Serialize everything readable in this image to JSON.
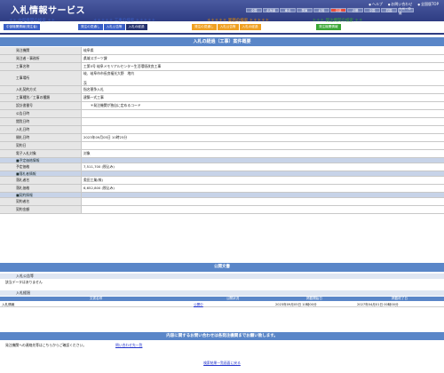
{
  "header": {
    "logo": "入札情報サービス",
    "links": [
      "ヘルプ",
      "お問い合わせ",
      "全国版TOP"
    ],
    "regions": [
      "全国",
      "北海道",
      "東北",
      "関東",
      "北陸",
      "中部",
      "近畿",
      "中国",
      "四国",
      "九州・沖縄"
    ],
    "active_region": "中部"
  },
  "nav": {
    "group1": {
      "label": "＊＊＊＊＊ 工事の検索 ＊＊＊＊＊",
      "tabs": [
        "発注の見通し",
        "入札公告等",
        "入札の経過"
      ],
      "selected": "入札の経過"
    },
    "group2": {
      "label": "＊＊＊＊＊ 業務の検索 ＊＊＊＊＊",
      "tabs": [
        "発注の見通し",
        "入札公告等",
        "入札の経過"
      ]
    },
    "group3": {
      "label": "＊＊＊ 発注機関の検索 ＊＊＊",
      "tabs": [
        "発注機関情報"
      ]
    },
    "left_label": "＊＊ 中部機関の検索 ＊＊",
    "left_tab": "中部機関情報(発注者)"
  },
  "detail": {
    "title": "入札の経過（工事）案件概要",
    "rows": [
      {
        "label": "発注機関",
        "value": "岐阜県"
      },
      {
        "label": "発注者・事務所",
        "value": "県域スポーツ課"
      },
      {
        "label": "工事名称",
        "value": "工第5号  岐阜メモリアルセンター生活環境改良工事"
      },
      {
        "label": "工事場所",
        "value": "岐、岐阜市市長良福光大野　地内\n\n茨"
      },
      {
        "label": "入札契約方式",
        "value": "指名競争入札"
      },
      {
        "label": "工事種別／工事の種類",
        "value": "建築一式工事"
      },
      {
        "label": "設計書番号",
        "value": "　　＊発注機関が独自に定めるコード"
      },
      {
        "label": "公告日時",
        "value": ""
      },
      {
        "label": "閲覧日時",
        "value": ""
      },
      {
        "label": "入札日時",
        "value": ""
      },
      {
        "label": "開札日時",
        "value": "2023年09月05日 10時25分"
      },
      {
        "label": "契約日",
        "value": ""
      },
      {
        "label": "電子入札対象",
        "value": "対象"
      },
      {
        "label": "■予定価格情報",
        "value": "",
        "section": true
      },
      {
        "label": "予定価格",
        "value": "7,511,700 (税込み)"
      },
      {
        "label": "■落札者情報",
        "value": "",
        "section": true
      },
      {
        "label": "落札者名",
        "value": "奥田工業(株)"
      },
      {
        "label": "落札価格",
        "value": "6,652,800 (税込み)"
      },
      {
        "label": "■契約情報",
        "value": "",
        "section": true
      },
      {
        "label": "契約者名",
        "value": ""
      },
      {
        "label": "契約金額",
        "value": ""
      }
    ]
  },
  "public_docs": {
    "band": "公開文書",
    "sub1": "入札公告等",
    "sub1_text": "該当データはありません",
    "sub2": "入札経過",
    "columns": [
      "文書名称",
      "公開状況",
      "掲載開始日",
      "掲載終了日"
    ],
    "rows": [
      [
        "入札情報",
        "公開中",
        "2023年09月05日 10時00分",
        "2027年04月01日 00時00分"
      ]
    ]
  },
  "contact": {
    "band": "内容に関するお問い合わせは各発注機関までお願い致します。",
    "text": "発注機関への連絡先等はこちらからご確認ください。",
    "link": "問い合わせ先一覧"
  },
  "back_link": "検索結果一覧画面に戻る"
}
